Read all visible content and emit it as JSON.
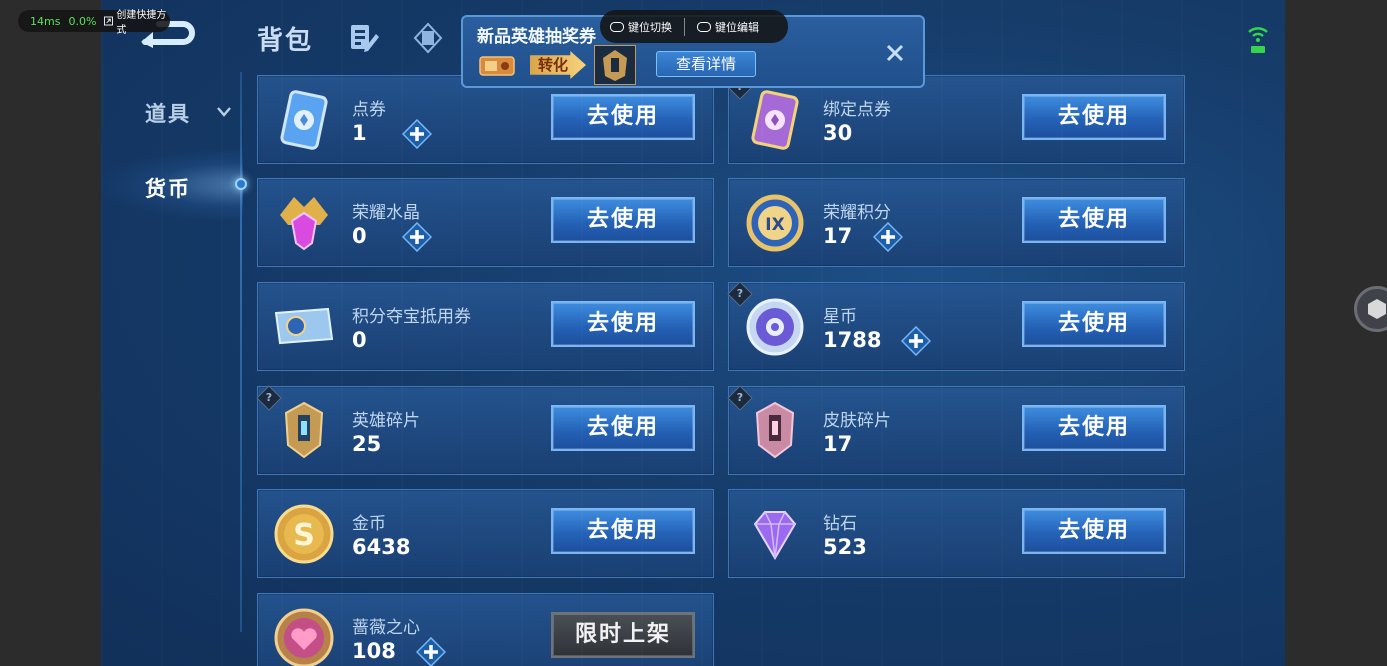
{
  "top_nav": {
    "backpack": "背包"
  },
  "sidebar": {
    "items": [
      {
        "label": "道具"
      },
      {
        "label": "货币"
      }
    ]
  },
  "popup": {
    "title": "新品英雄抽奖券",
    "convert_label": "转化",
    "details_button": "查看详情"
  },
  "overlay": {
    "latency": "14ms",
    "cpu": "0.0%",
    "shortcut": "创建快捷方式",
    "key_switch": "键位切换",
    "key_edit": "键位编辑"
  },
  "currencies": [
    {
      "name": "点券",
      "value": "1",
      "button": "去使用",
      "icon": "voucher-card-icon",
      "plus": true,
      "help": false
    },
    {
      "name": "绑定点券",
      "value": "30",
      "button": "去使用",
      "icon": "bound-voucher-card-icon",
      "plus": false,
      "help": true
    },
    {
      "name": "荣耀水晶",
      "value": "0",
      "button": "去使用",
      "icon": "glory-crystal-icon",
      "plus": true,
      "help": false
    },
    {
      "name": "荣耀积分",
      "value": "17",
      "button": "去使用",
      "icon": "glory-points-icon",
      "plus": true,
      "help": false
    },
    {
      "name": "积分夺宝抵用券",
      "value": "0",
      "button": "去使用",
      "icon": "points-lottery-ticket-icon",
      "plus": false,
      "help": false
    },
    {
      "name": "星币",
      "value": "1788",
      "button": "去使用",
      "icon": "star-coin-icon",
      "plus": true,
      "help": true
    },
    {
      "name": "英雄碎片",
      "value": "25",
      "button": "去使用",
      "icon": "hero-fragment-icon",
      "plus": false,
      "help": true
    },
    {
      "name": "皮肤碎片",
      "value": "17",
      "button": "去使用",
      "icon": "skin-fragment-icon",
      "plus": false,
      "help": true
    },
    {
      "name": "金币",
      "value": "6438",
      "button": "去使用",
      "icon": "gold-coin-icon",
      "plus": false,
      "help": false
    },
    {
      "name": "钻石",
      "value": "523",
      "button": "去使用",
      "icon": "diamond-icon",
      "plus": false,
      "help": false
    },
    {
      "name": "蔷薇之心",
      "value": "108",
      "button": "限时上架",
      "icon": "rose-heart-icon",
      "plus": true,
      "help": false,
      "disabled": true
    }
  ]
}
